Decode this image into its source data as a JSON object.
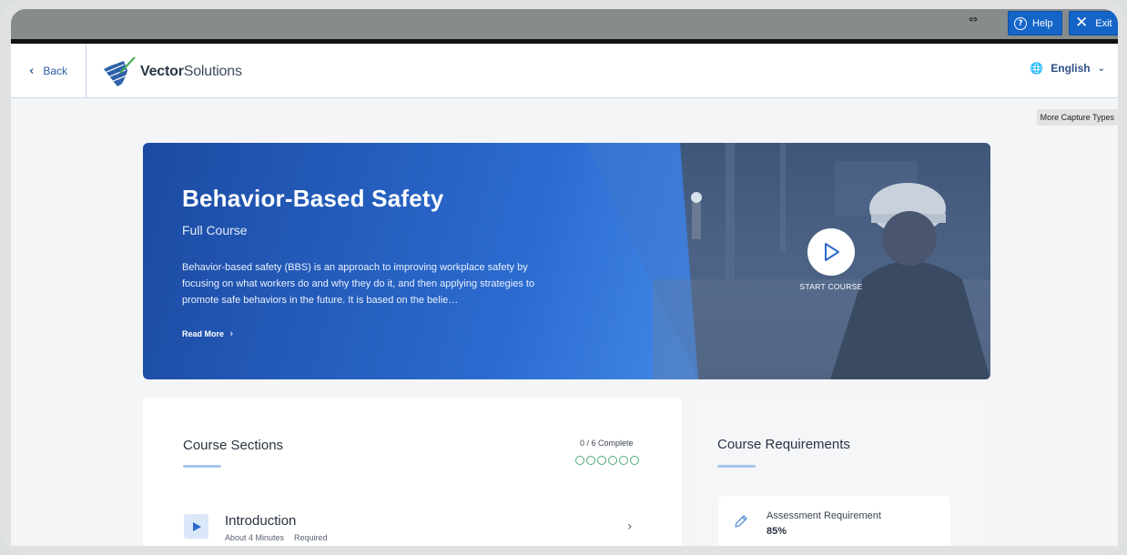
{
  "topbar": {
    "help_label": "Help",
    "exit_label": "Exit",
    "resize_icon": "⇔"
  },
  "header": {
    "back_label": "Back",
    "logo_bold": "Vector",
    "logo_light": "Solutions",
    "language": "English"
  },
  "tooltip": "More Capture Types",
  "hero": {
    "title": "Behavior-Based Safety",
    "subtitle": "Full Course",
    "description": "Behavior-based safety (BBS) is an approach to improving workplace safety by focusing on what workers do and why they do it, and then applying strategies to promote safe behaviors in the future. It is based on the belie…",
    "read_more": "Read More",
    "start_label": "START COURSE"
  },
  "sections": {
    "title": "Course Sections",
    "progress": "0 / 6 Complete",
    "progress_fraction": 0,
    "items": [
      {
        "title": "Introduction",
        "duration": "About 4 Minutes",
        "status": "Required"
      }
    ]
  },
  "requirements": {
    "title": "Course Requirements",
    "items": [
      {
        "label": "Assessment Requirement",
        "value": "85%"
      }
    ]
  },
  "colors": {
    "accent": "#1565c8",
    "hero_dark": "#1c4aa2",
    "progress_ring": "#4caa74"
  }
}
